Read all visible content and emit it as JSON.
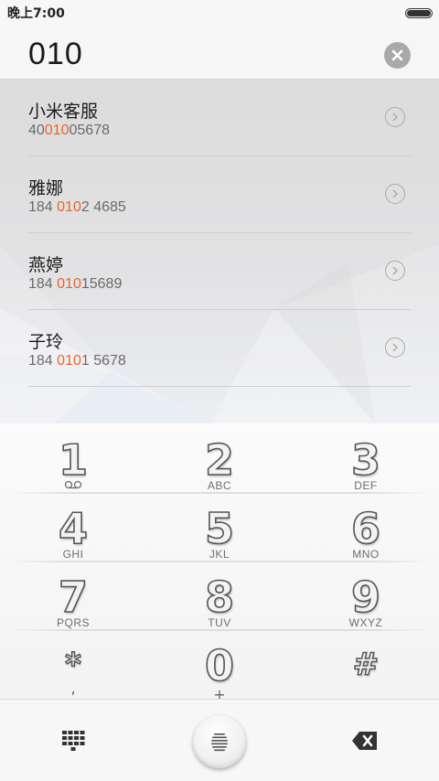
{
  "status_bar": {
    "time": "晚上7:00",
    "battery_icon": "battery-icon"
  },
  "dial_entry": {
    "number": "010",
    "clear_icon": "clear-icon"
  },
  "highlight_color": "#e8662a",
  "contacts": [
    {
      "name": "小米客服",
      "number_pre": "40",
      "number_match": "010",
      "number_post": "05678"
    },
    {
      "name": "雅娜",
      "number_pre": "184 ",
      "number_match": "010",
      "number_post": "2 4685"
    },
    {
      "name": "燕婷",
      "number_pre": "184 ",
      "number_match": "010",
      "number_post": "15689"
    },
    {
      "name": "子玲",
      "number_pre": "184 ",
      "number_match": "010",
      "number_post": "1 5678"
    }
  ],
  "keypad": {
    "keys": [
      {
        "digit": "1",
        "letters": ""
      },
      {
        "digit": "2",
        "letters": "ABC"
      },
      {
        "digit": "3",
        "letters": "DEF"
      },
      {
        "digit": "4",
        "letters": "GHI"
      },
      {
        "digit": "5",
        "letters": "JKL"
      },
      {
        "digit": "6",
        "letters": "MNO"
      },
      {
        "digit": "7",
        "letters": "PQRS"
      },
      {
        "digit": "8",
        "letters": "TUV"
      },
      {
        "digit": "9",
        "letters": "WXYZ"
      }
    ],
    "star": {
      "symbol": "*",
      "sub": ","
    },
    "zero": {
      "digit": "0",
      "sub": "+"
    },
    "hash": {
      "symbol": "#",
      "sub": ""
    }
  },
  "bottom_bar": {
    "dialpad_icon": "dialpad-grid-icon",
    "call_icon": "call-icon",
    "backspace_icon": "backspace-icon"
  }
}
